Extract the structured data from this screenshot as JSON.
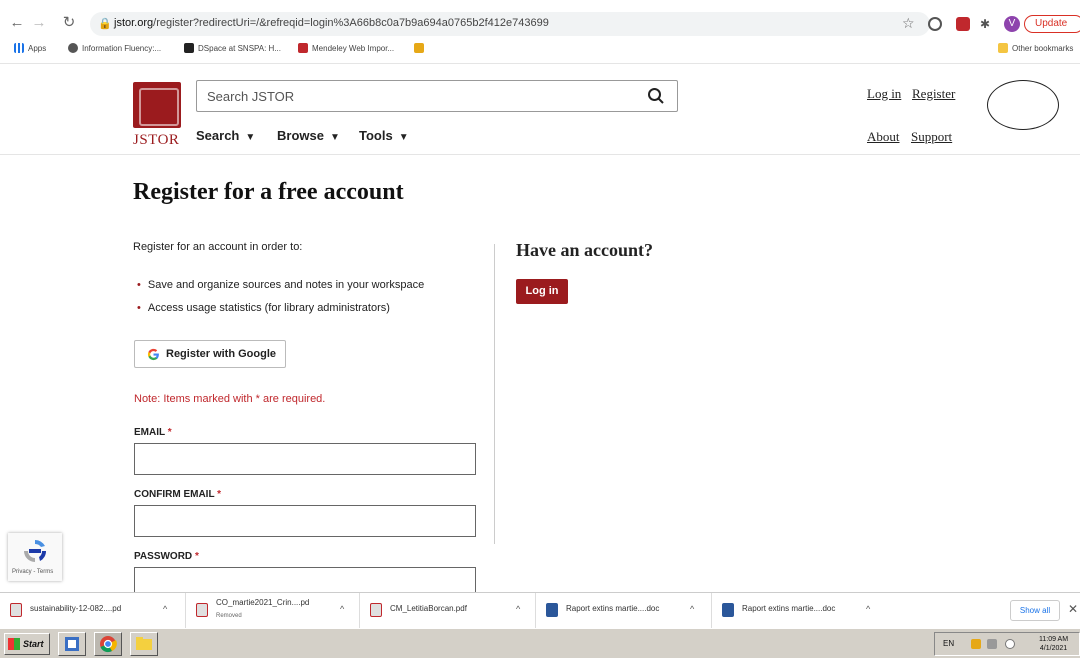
{
  "browser": {
    "url_host": "jstor.org",
    "url_path": "/register?redirectUri=/&refreqid=login%3A66b8c0a7b9a694a0765b2f412e743699",
    "update_label": "Update",
    "avatar_letter": "V",
    "bookmarks": [
      {
        "label": "Apps"
      },
      {
        "label": "Information Fluency:..."
      },
      {
        "label": "DSpace at SNSPA: H..."
      },
      {
        "label": "Mendeley Web Impor..."
      }
    ],
    "other_bookmarks": "Other bookmarks"
  },
  "header": {
    "logo_text": "JSTOR",
    "search_placeholder": "Search JSTOR",
    "nav": {
      "search": "Search",
      "browse": "Browse",
      "tools": "Tools"
    },
    "login": "Log in",
    "register": "Register",
    "about": "About",
    "support": "Support"
  },
  "main": {
    "title": "Register for a free account",
    "intro": "Register for an account in order to:",
    "bullets": [
      "Save and organize sources and notes in your workspace",
      "Access usage statistics (for library administrators)"
    ],
    "google_button": "Register with Google",
    "note": "Note: Items marked with * are required.",
    "email_label": "EMAIL",
    "confirm_email_label": "CONFIRM EMAIL",
    "password_label": "PASSWORD",
    "required_mark": "*",
    "have_account": "Have an account?",
    "login_button": "Log in"
  },
  "recaptcha": {
    "text": "Privacy - Terms"
  },
  "downloads": {
    "items": [
      {
        "name": "sustainability-12-082....pd",
        "sub": ""
      },
      {
        "name": "CO_martie2021_Crin....pd",
        "sub": "Removed"
      },
      {
        "name": "CM_LetitiaBorcan.pdf",
        "sub": ""
      },
      {
        "name": "Raport extins martie....doc",
        "sub": ""
      },
      {
        "name": "Raport extins martie....doc",
        "sub": ""
      }
    ],
    "show_all": "Show all"
  },
  "taskbar": {
    "start": "Start",
    "lang": "EN",
    "time": "11:09 AM",
    "date": "4/1/2021"
  }
}
